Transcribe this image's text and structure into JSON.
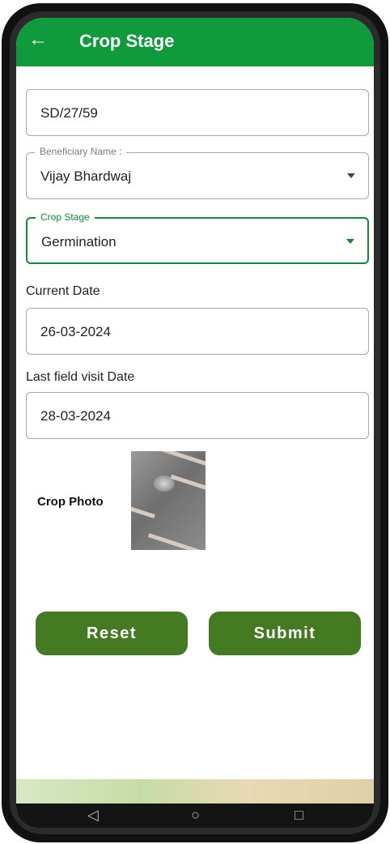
{
  "appbar": {
    "title": "Crop Stage",
    "back_icon": "arrow-left-icon"
  },
  "form": {
    "id_value": "SD/27/59",
    "beneficiary": {
      "label": "Beneficiary Name :",
      "value": "Vijay Bhardwaj"
    },
    "crop_stage": {
      "label": "Crop Stage",
      "value": "Germination"
    },
    "current_date": {
      "label": "Current Date",
      "value": "26-03-2024"
    },
    "last_visit": {
      "label": "Last field visit Date",
      "value": "28-03-2024"
    },
    "photo_label": "Crop Photo"
  },
  "buttons": {
    "reset": "Reset",
    "submit": "Submit"
  },
  "navbar": {
    "back": "◁",
    "home": "○",
    "recents": "□"
  },
  "colors": {
    "appbar": "#0f9a3c",
    "button": "#447a22",
    "focus": "#12893a"
  }
}
